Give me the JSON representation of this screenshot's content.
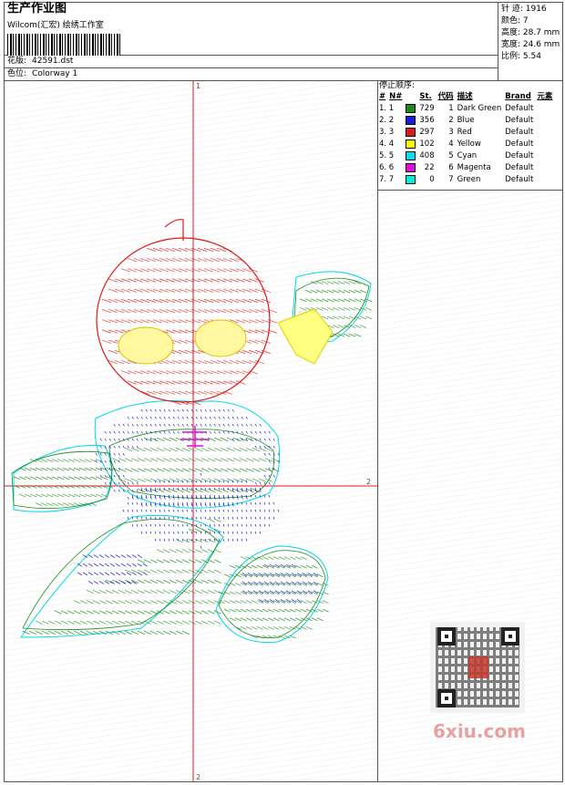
{
  "header": {
    "title": "生产作业图",
    "subtitle": "Wilcom(汇宏) 绘绣工作室",
    "file_label": "花版:",
    "file_value": "42591.dst",
    "colorway_label": "色位:",
    "colorway_value": "Colorway 1"
  },
  "stats": {
    "stitches": "针 迹: 1916",
    "colors": "颜色: 7",
    "height": "高度: 28.7 mm",
    "width": "宽度: 24.6 mm",
    "ratio": "比例: 5.54"
  },
  "stop_sequence": {
    "label": "停止顺序:",
    "headers": [
      "#",
      "N#",
      "St.",
      "代码",
      "描述",
      "Brand",
      "元素"
    ],
    "rows": [
      {
        "idx": "1. 1",
        "color": "#1a8c1a",
        "st": "729",
        "code": "1",
        "desc": "Dark Green",
        "brand": "Default"
      },
      {
        "idx": "2. 2",
        "color": "#1a1adc",
        "st": "356",
        "code": "2",
        "desc": "Blue",
        "brand": "Default"
      },
      {
        "idx": "3. 3",
        "color": "#e01a1a",
        "st": "297",
        "code": "3",
        "desc": "Red",
        "brand": "Default"
      },
      {
        "idx": "4. 4",
        "color": "#ffff00",
        "st": "102",
        "code": "4",
        "desc": "Yellow",
        "brand": "Default"
      },
      {
        "idx": "5. 5",
        "color": "#00e0f0",
        "st": "408",
        "code": "5",
        "desc": "Cyan",
        "brand": "Default"
      },
      {
        "idx": "6. 6",
        "color": "#e010e0",
        "st": "22",
        "code": "6",
        "desc": "Magenta",
        "brand": "Default"
      },
      {
        "idx": "7. 7",
        "color": "#00f0e0",
        "st": "0",
        "code": "7",
        "desc": "Green",
        "brand": "Default"
      }
    ]
  },
  "axes": {
    "top_marker": "1",
    "bottom_marker": "2",
    "right_marker": "2"
  },
  "watermark": "6xiu.com"
}
